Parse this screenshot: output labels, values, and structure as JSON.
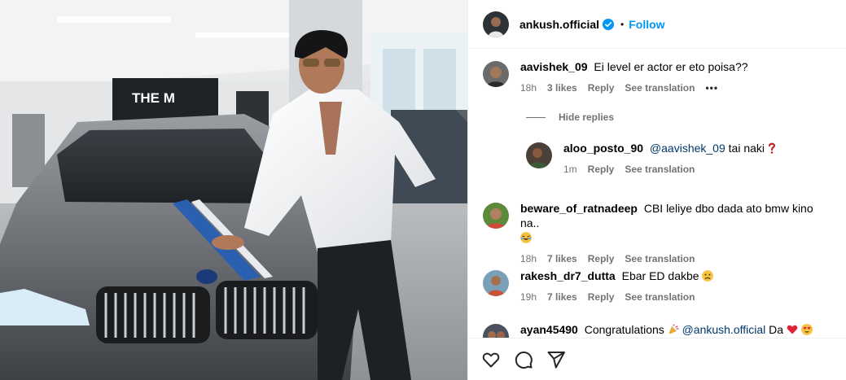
{
  "post": {
    "author": "ankush.official",
    "follow_label": "Follow",
    "dot": "•",
    "photo_sign": "THE M"
  },
  "comments": [
    {
      "user": "aavishek_09",
      "text": "Ei level er actor er eto poisa??",
      "time": "18h",
      "likes": "3 likes",
      "reply": "Reply",
      "translate": "See translation",
      "more": "•••"
    },
    {
      "user": "aloo_posto_90",
      "mention": "@aavishek_09",
      "text": "tai naki",
      "time": "1m",
      "reply": "Reply",
      "translate": "See translation"
    },
    {
      "user": "beware_of_ratnadeep",
      "text": "CBI leliye dbo dada ato bmw kino na..",
      "time": "18h",
      "likes": "7 likes",
      "reply": "Reply",
      "translate": "See translation"
    },
    {
      "user": "rakesh_dr7_dutta",
      "text": "Ebar ED dakbe",
      "time": "19h",
      "likes": "7 likes",
      "reply": "Reply",
      "translate": "See translation"
    },
    {
      "user": "ayan45490",
      "text": "Congratulations",
      "mention": "@ankush.official",
      "text2": "Da"
    }
  ],
  "hide_replies_label": "Hide replies",
  "icons": {
    "like": "heart-icon",
    "comment": "comment-icon",
    "share": "share-icon"
  },
  "colors": {
    "accent": "#0095f6",
    "muted": "#737373",
    "mention": "#00376b"
  }
}
